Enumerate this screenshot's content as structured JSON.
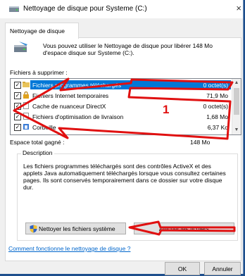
{
  "window": {
    "title": "Nettoyage de disque pour Systeme (C:)",
    "close_glyph": "×"
  },
  "tab": {
    "label": "Nettoyage de disque"
  },
  "intro": {
    "text": "Vous pouvez utiliser le Nettoyage de disque pour libérer 148 Mo d'espace disque sur Systeme (C:)."
  },
  "files_label": "Fichiers à supprimer :",
  "files": [
    {
      "name": "Fichiers programmes téléchargés",
      "size": "0 octet(s)",
      "checked": true,
      "selected": true,
      "icon": "folder-icon"
    },
    {
      "name": "Fichiers Internet temporaires",
      "size": "71,9 Mo",
      "checked": true,
      "selected": false,
      "icon": "lock-icon"
    },
    {
      "name": "Cache de nuanceur DirectX",
      "size": "0 octet(s)",
      "checked": true,
      "selected": false,
      "icon": "file-icon"
    },
    {
      "name": "Fichiers d'optimisation de livraison",
      "size": "1,68 Mo",
      "checked": true,
      "selected": false,
      "icon": "file-icon"
    },
    {
      "name": "Corbeille",
      "size": "6,37 Ko",
      "checked": true,
      "selected": false,
      "icon": "recycle-bin-icon"
    }
  ],
  "check_glyph": "✓",
  "scroll": {
    "up": "▲",
    "down": "▼"
  },
  "gain": {
    "label": "Espace total gagné :",
    "value": "148 Mo"
  },
  "description": {
    "legend": "Description",
    "text": "Les fichiers programmes téléchargés sont des contrôles ActiveX et des applets Java automatiquement téléchargés lorsque vous consultez certaines pages. Ils sont conservés temporairement dans ce dossier sur votre disque dur."
  },
  "buttons": {
    "clean_system": "Nettoyer les fichiers système",
    "show_files": "Afficher les fichiers",
    "ok": "OK",
    "cancel": "Annuler"
  },
  "help_link": "Comment fonctionne le nettoyage de disque ?",
  "annotation": {
    "number": "1",
    "color": "#e01010"
  },
  "colors": {
    "selection": "#0078d7",
    "link": "#0066cc",
    "background": "#1d4e8c"
  }
}
